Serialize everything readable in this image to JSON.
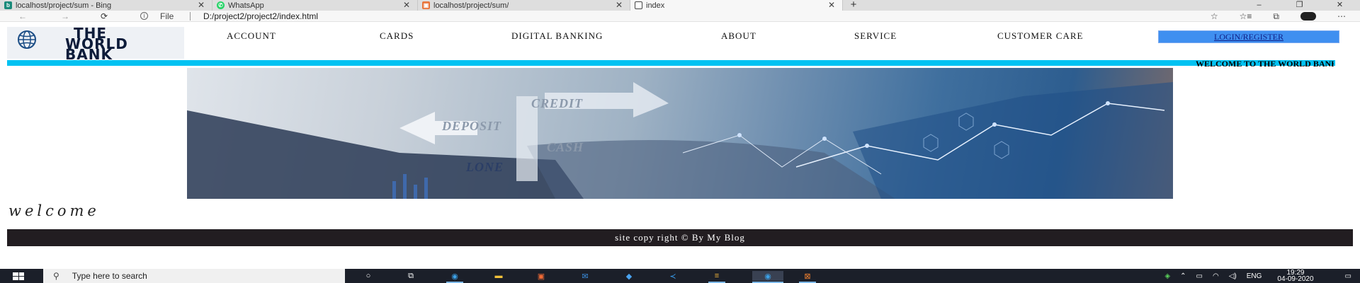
{
  "browser": {
    "tabs": [
      {
        "title": "localhost/project/sum - Bing",
        "favicon_color": "#1b8a7a",
        "active": false
      },
      {
        "title": "WhatsApp",
        "favicon_color": "#25d366",
        "active": false
      },
      {
        "title": "localhost/project/sum/",
        "favicon_color": "#e8743a",
        "active": false
      },
      {
        "title": "index",
        "favicon_color": "#ffffff",
        "active": true
      }
    ],
    "tab_close": "✕",
    "new_tab": "+",
    "window_controls": [
      "–",
      "❐",
      "✕"
    ],
    "address_bar": {
      "back": "←",
      "forward": "→",
      "refresh": "⟳",
      "info_icon": "i",
      "scheme_label": "File",
      "url": "D:/project2/project2/index.html",
      "right_icons": [
        "☆",
        "☆≡",
        "⧉",
        "⋯"
      ]
    }
  },
  "site": {
    "logo": {
      "lines": [
        "THE",
        "WORLD",
        "BANK"
      ]
    },
    "nav": [
      "ACCOUNT",
      "CARDS",
      "DIGITAL BANKING",
      "ABOUT",
      "SERVICE",
      "CUSTOMER CARE"
    ],
    "login_label": "LOGIN/REGISTER",
    "marquee": "WELCOME TO THE WORLD BANK",
    "banner_words": [
      "CREDIT",
      "DEPOSIT",
      "CASH",
      "LONE"
    ],
    "welcome": "welcome",
    "footer": "site copy right © By My Blog"
  },
  "taskbar": {
    "search_placeholder": "Type here to search",
    "tray_lang": "ENG",
    "time": "19:29",
    "date": "04-09-2020"
  },
  "colors": {
    "accent_bar": "#00c2f2",
    "login_button": "#3f8ff0",
    "footer_bg": "#221d21",
    "taskbar_bg": "#1b1f29"
  }
}
